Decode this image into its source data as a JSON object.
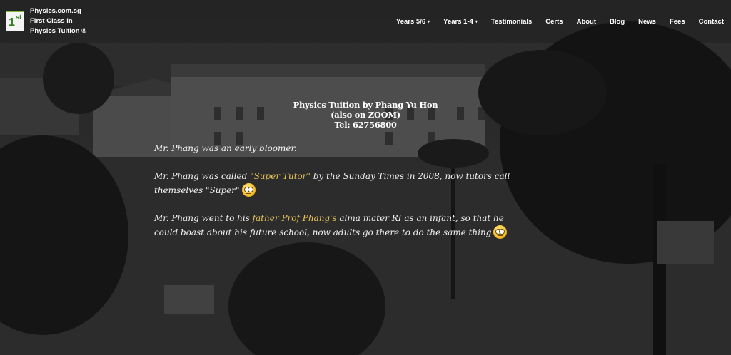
{
  "brand": {
    "name": "Physics.com.sg",
    "tagline_1": "First Class in",
    "tagline_2": "Physics Tuition ®",
    "logo_main": "1",
    "logo_sup": "st"
  },
  "nav": {
    "items": [
      {
        "label": "Years 5/6",
        "dropdown": true
      },
      {
        "label": "Years 1-4",
        "dropdown": true
      },
      {
        "label": "Testimonials",
        "dropdown": false
      },
      {
        "label": "Certs",
        "dropdown": false
      },
      {
        "label": "About",
        "dropdown": false
      },
      {
        "label": "Blog",
        "dropdown": false
      },
      {
        "label": "News",
        "dropdown": false
      },
      {
        "label": "Fees",
        "dropdown": false
      },
      {
        "label": "Contact",
        "dropdown": false
      }
    ],
    "caret_icon": "▾"
  },
  "hero": {
    "title": "Physics Tuition by Phang Yu Hon",
    "subtitle": "(also on ZOOM)",
    "tel": "Tel: 62756800"
  },
  "content": {
    "p1": "Mr. Phang was an early bloomer.",
    "p2_before": "Mr. Phang was called ",
    "p2_link": "\"Super Tutor\"",
    "p2_after": " by the Sunday Times in 2008, now tutors call themselves \"Super\"",
    "p3_before": "Mr. Phang went to his ",
    "p3_link": "father Prof Phang's",
    "p3_after": " alma mater RI as an infant, so that he could boast about his future school, now adults go there to do the same thing"
  },
  "colors": {
    "link": "#e8c25a",
    "logo_green": "#2e7d1e"
  },
  "icons": {
    "emoji": "rolling-eyes-emoji-icon"
  }
}
